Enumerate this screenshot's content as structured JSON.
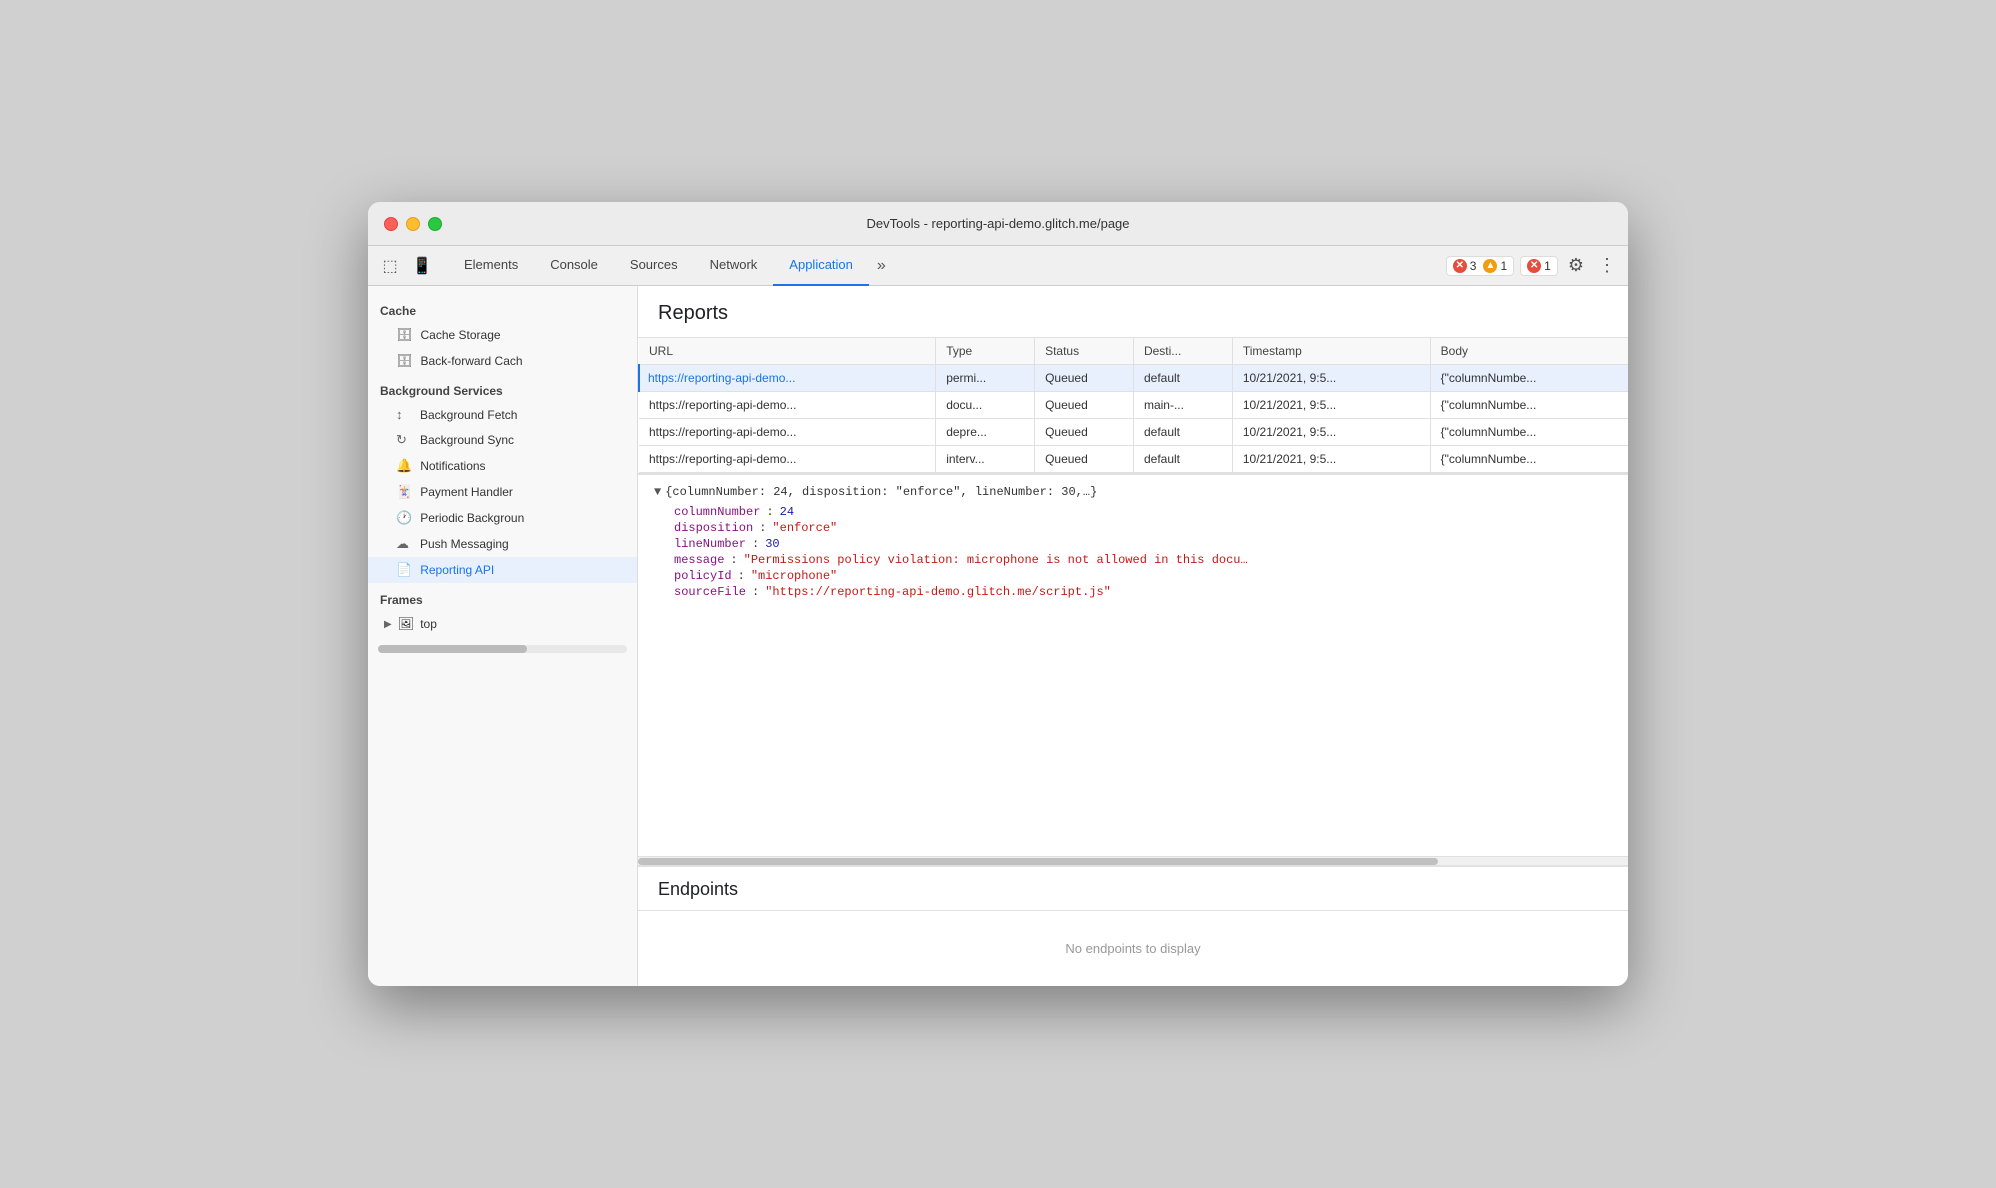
{
  "window": {
    "title": "DevTools - reporting-api-demo.glitch.me/page"
  },
  "toolbar": {
    "tabs": [
      {
        "label": "Elements",
        "active": false
      },
      {
        "label": "Console",
        "active": false
      },
      {
        "label": "Sources",
        "active": false
      },
      {
        "label": "Network",
        "active": false
      },
      {
        "label": "Application",
        "active": true
      }
    ],
    "error_badge_1": "3",
    "warning_badge": "1",
    "error_badge_2": "1"
  },
  "sidebar": {
    "cache_header": "Cache",
    "cache_items": [
      {
        "label": "Cache Storage",
        "icon": "🗄"
      },
      {
        "label": "Back-forward Cach",
        "icon": "🗄"
      }
    ],
    "bg_services_header": "Background Services",
    "bg_services_items": [
      {
        "label": "Background Fetch",
        "icon": "↕"
      },
      {
        "label": "Background Sync",
        "icon": "↻"
      },
      {
        "label": "Notifications",
        "icon": "🔔"
      },
      {
        "label": "Payment Handler",
        "icon": "🪙"
      },
      {
        "label": "Periodic Backgroun",
        "icon": "🕐"
      },
      {
        "label": "Push Messaging",
        "icon": "☁"
      },
      {
        "label": "Reporting API",
        "icon": "📄",
        "active": true
      }
    ],
    "frames_header": "Frames",
    "frames_item": "top"
  },
  "reports": {
    "section_title": "Reports",
    "columns": [
      "URL",
      "Type",
      "Status",
      "Desti...",
      "Timestamp",
      "Body"
    ],
    "rows": [
      {
        "url": "https://reporting-api-demo...",
        "type": "permi...",
        "status": "Queued",
        "dest": "default",
        "timestamp": "10/21/2021, 9:5...",
        "body": "{\"columnNumbe...",
        "selected": true
      },
      {
        "url": "https://reporting-api-demo...",
        "type": "docu...",
        "status": "Queued",
        "dest": "main-...",
        "timestamp": "10/21/2021, 9:5...",
        "body": "{\"columnNumbe...",
        "selected": false
      },
      {
        "url": "https://reporting-api-demo...",
        "type": "depre...",
        "status": "Queued",
        "dest": "default",
        "timestamp": "10/21/2021, 9:5...",
        "body": "{\"columnNumbe...",
        "selected": false
      },
      {
        "url": "https://reporting-api-demo...",
        "type": "interv...",
        "status": "Queued",
        "dest": "default",
        "timestamp": "10/21/2021, 9:5...",
        "body": "{\"columnNumbe...",
        "selected": false
      }
    ]
  },
  "detail": {
    "header": "{columnNumber: 24, disposition: \"enforce\", lineNumber: 30,…}",
    "fields": [
      {
        "key": "columnNumber",
        "colon": ":",
        "value": "24",
        "type": "num"
      },
      {
        "key": "disposition",
        "colon": ":",
        "value": "\"enforce\"",
        "type": "str"
      },
      {
        "key": "lineNumber",
        "colon": ":",
        "value": "30",
        "type": "num"
      },
      {
        "key": "message",
        "colon": ":",
        "value": "\"Permissions policy violation: microphone is not allowed in this docu…",
        "type": "str"
      },
      {
        "key": "policyId",
        "colon": ":",
        "value": "\"microphone\"",
        "type": "str"
      },
      {
        "key": "sourceFile",
        "colon": ":",
        "value": "\"https://reporting-api-demo.glitch.me/script.js\"",
        "type": "str"
      }
    ]
  },
  "endpoints": {
    "title": "Endpoints",
    "empty_text": "No endpoints to display"
  }
}
